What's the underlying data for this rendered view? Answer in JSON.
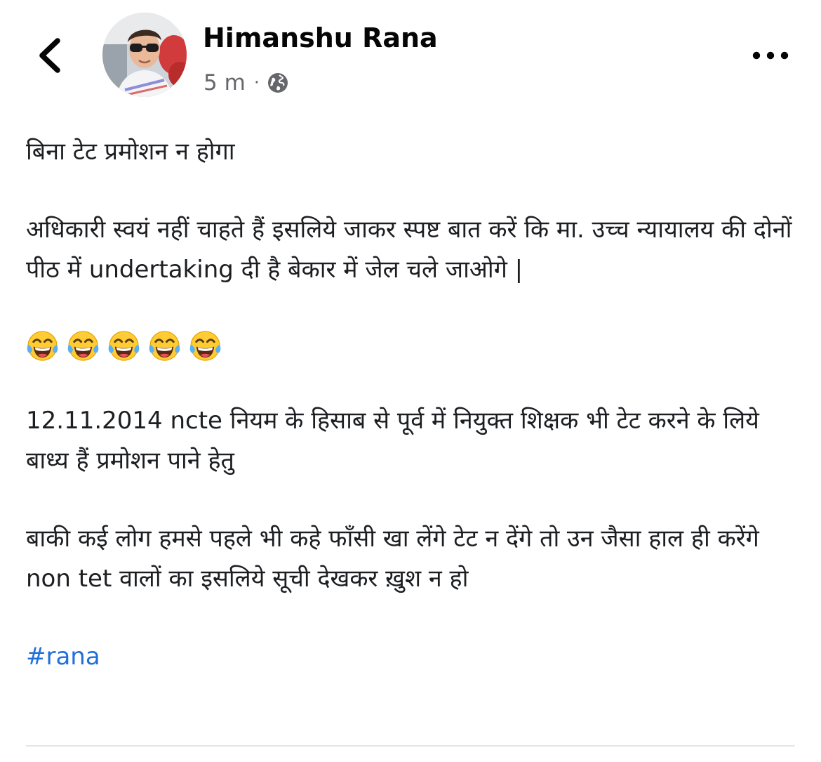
{
  "post": {
    "author_name": "Himanshu Rana",
    "timestamp": "5 m",
    "separator": "·",
    "audience_icon": "globe-icon",
    "paragraphs": [
      "बिना टेट प्रमोशन न होगा",
      "अधिकारी स्वयं नहीं चाहते हैं इसलिये जाकर स्पष्ट बात करें कि मा. उच्च न्यायालय की दोनों पीठ में undertaking दी है बेकार में जेल चले जाओगे |",
      "12.11.2014 ncte नियम के हिसाब से पूर्व में नियुक्त शिक्षक भी टेट करने के लिये बाध्य हैं प्रमोशन पाने हेतु",
      "बाकी कई लोग हमसे पहले भी कहे फाँसी खा लेंगे टेट न देंगे तो उन जैसा हाल ही करेंगे non tet वालों का इसलिये सूची देखकर ख़ुश न हो"
    ],
    "emoji_count": 5,
    "emoji_name": "face-with-tears-of-joy-icon",
    "hashtag": "#rana"
  },
  "header": {
    "back_icon": "chevron-left-icon",
    "more_icon": "more-horizontal-icon"
  },
  "colors": {
    "link": "#216fdb",
    "secondary_text": "#65676b",
    "primary_text": "#1c1e21",
    "divider": "#e4e6eb",
    "emoji_face": "#ffcc33",
    "emoji_tears": "#5ab0f2"
  }
}
